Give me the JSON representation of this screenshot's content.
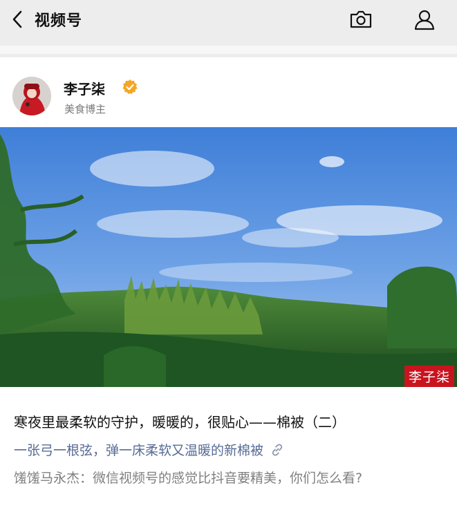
{
  "header": {
    "title": "视频号",
    "back_icon": "chevron-left-icon",
    "camera_icon": "camera-icon",
    "profile_icon": "person-icon"
  },
  "post": {
    "author": {
      "name": "李子柒",
      "tag": "美食博主",
      "verified": true,
      "verified_color": "#f5a623"
    },
    "watermark": "李子柒",
    "title": "寒夜里最柔软的守护，暖暖的，很贴心——棉被（二）",
    "topic": "一张弓一根弦，弹一床柔软又温暖的新棉被",
    "comment": "馐馐马永杰：微信视频号的感觉比抖音要精美，你们怎么看?"
  },
  "colors": {
    "link": "#576b95",
    "secondary_text": "#7f7f7f",
    "background": "#ededed"
  }
}
